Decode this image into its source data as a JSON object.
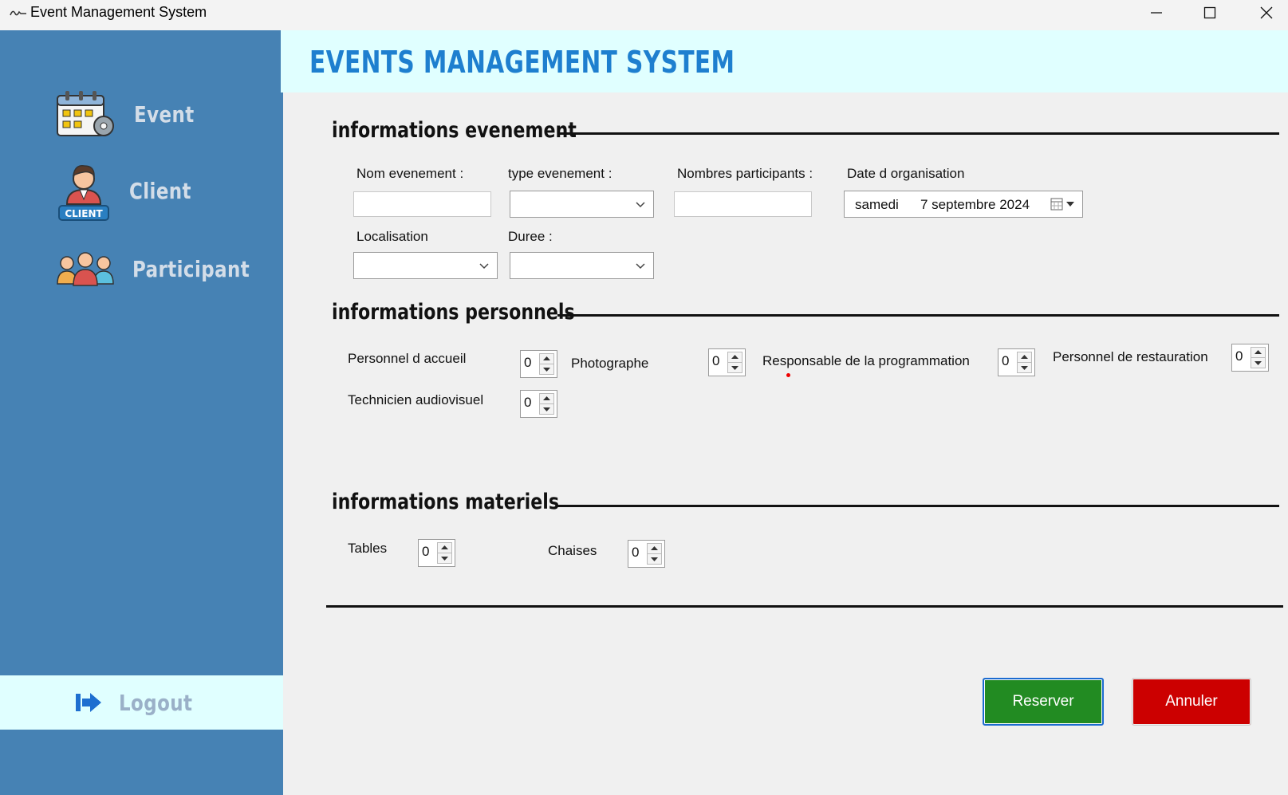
{
  "window": {
    "title": "Event Management System"
  },
  "sidebar": {
    "items": [
      {
        "label": "Event",
        "icon": "calendar-gear-icon"
      },
      {
        "label": "Client",
        "icon": "client-icon",
        "badge": "CLIENT"
      },
      {
        "label": "Participant",
        "icon": "participants-icon"
      }
    ],
    "logout": {
      "label": "Logout",
      "icon": "logout-arrow-icon"
    }
  },
  "header": {
    "title": "EVENTS MANAGEMENT SYSTEM"
  },
  "event_info": {
    "heading": "informations evenement",
    "nom_label": "Nom evenement :",
    "nom_value": "",
    "type_label": "type evenement :",
    "type_value": "",
    "participants_label": "Nombres participants :",
    "participants_value": "",
    "date_label": "Date d organisation",
    "date_day": "samedi",
    "date_value": "7 septembre 2024",
    "localisation_label": "Localisation",
    "localisation_value": "",
    "duree_label": "Duree :",
    "duree_value": ""
  },
  "personnel_info": {
    "heading": "informations personnels",
    "fields": [
      {
        "label": "Personnel d accueil",
        "value": "0"
      },
      {
        "label": "Photographe",
        "value": "0"
      },
      {
        "label": "Responsable de la programmation",
        "value": "0"
      },
      {
        "label": "Personnel de restauration",
        "value": "0"
      },
      {
        "label": "Technicien audiovisuel",
        "value": "0"
      }
    ]
  },
  "materiel_info": {
    "heading": "informations materiels",
    "fields": [
      {
        "label": "Tables",
        "value": "0"
      },
      {
        "label": "Chaises",
        "value": "0"
      }
    ]
  },
  "actions": {
    "reserve_label": "Reserver",
    "cancel_label": "Annuler"
  },
  "colors": {
    "sidebar": "#4682b4",
    "header_bg": "#e0ffff",
    "title_blue": "#1e7fcf",
    "reserve_green": "#228b22",
    "cancel_red": "#cc0000"
  }
}
